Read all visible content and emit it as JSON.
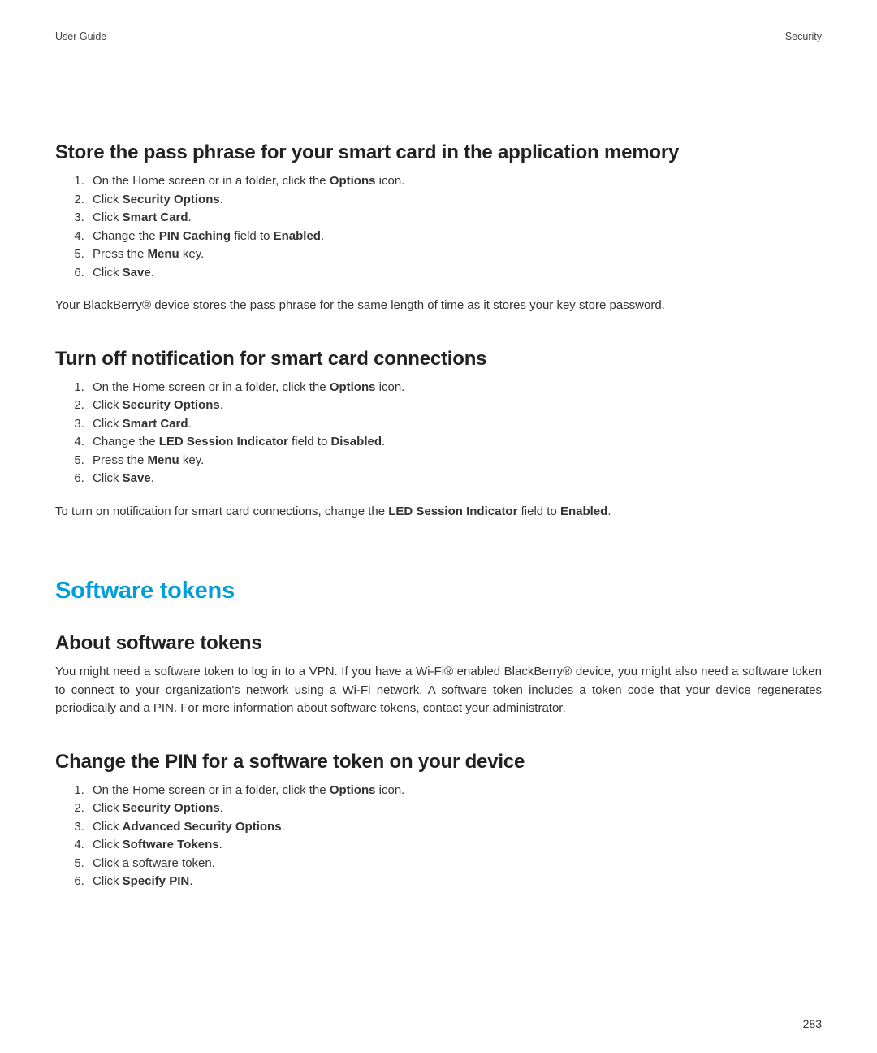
{
  "header": {
    "left": "User Guide",
    "right": "Security"
  },
  "sec1": {
    "title": "Store the pass phrase for your smart card in the application memory",
    "step1_a": "On the Home screen or in a folder, click the ",
    "step1_b": "Options",
    "step1_c": " icon.",
    "step2_a": "Click ",
    "step2_b": "Security Options",
    "step2_c": ".",
    "step3_a": "Click ",
    "step3_b": "Smart Card",
    "step3_c": ".",
    "step4_a": "Change the ",
    "step4_b": "PIN Caching",
    "step4_c": " field to ",
    "step4_d": "Enabled",
    "step4_e": ".",
    "step5_a": "Press the ",
    "step5_b": "Menu",
    "step5_c": " key.",
    "step6_a": "Click ",
    "step6_b": "Save",
    "step6_c": ".",
    "note": "Your BlackBerry® device stores the pass phrase for the same length of time as it stores your key store password."
  },
  "sec2": {
    "title": "Turn off notification for smart card connections",
    "step1_a": "On the Home screen or in a folder, click the ",
    "step1_b": "Options",
    "step1_c": " icon.",
    "step2_a": "Click ",
    "step2_b": "Security Options",
    "step2_c": ".",
    "step3_a": "Click ",
    "step3_b": "Smart Card",
    "step3_c": ".",
    "step4_a": "Change the ",
    "step4_b": "LED Session Indicator",
    "step4_c": " field to ",
    "step4_d": "Disabled",
    "step4_e": ".",
    "step5_a": "Press the ",
    "step5_b": "Menu",
    "step5_c": " key.",
    "step6_a": "Click ",
    "step6_b": "Save",
    "step6_c": ".",
    "note_a": "To turn on notification for smart card connections, change the ",
    "note_b": "LED Session Indicator",
    "note_c": " field to ",
    "note_d": "Enabled",
    "note_e": "."
  },
  "chapter": {
    "title": "Software tokens"
  },
  "sec3": {
    "title": "About software tokens",
    "body": "You might need a software token to log in to a VPN. If you have a Wi-Fi® enabled BlackBerry® device, you might also need a software token to connect to your organization's network using a Wi-Fi network. A software token includes a token code that your device regenerates periodically and a PIN. For more information about software tokens, contact your administrator."
  },
  "sec4": {
    "title": "Change the PIN for a software token on your device",
    "step1_a": "On the Home screen or in a folder, click the ",
    "step1_b": "Options",
    "step1_c": " icon.",
    "step2_a": "Click ",
    "step2_b": "Security Options",
    "step2_c": ".",
    "step3_a": "Click ",
    "step3_b": "Advanced Security Options",
    "step3_c": ".",
    "step4_a": "Click ",
    "step4_b": "Software Tokens",
    "step4_c": ".",
    "step5": "Click a software token.",
    "step6_a": "Click ",
    "step6_b": "Specify PIN",
    "step6_c": "."
  },
  "page_number": "283"
}
